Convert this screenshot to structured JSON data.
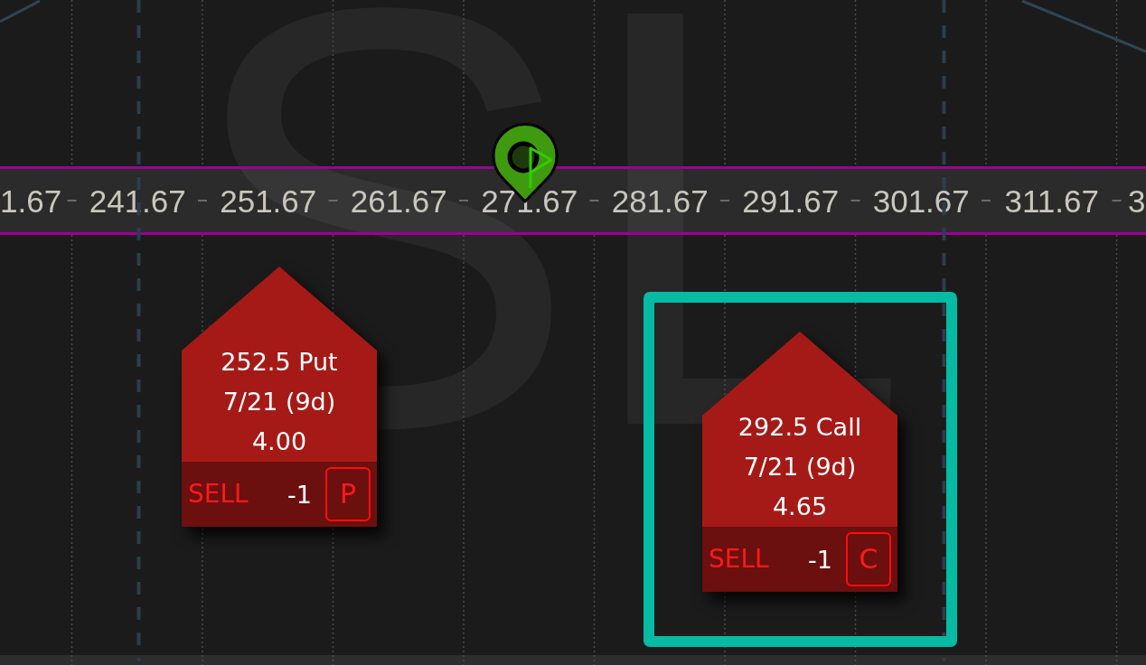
{
  "chart": {
    "background_symbol": "SL",
    "price_axis": {
      "labels": [
        "1.67",
        "241.67",
        "251.67",
        "261.67",
        "271.67",
        "281.67",
        "291.67",
        "301.67",
        "311.67",
        "3"
      ]
    },
    "orders": [
      {
        "strike": "252.5 Put",
        "expiration": "7/21 (9d)",
        "price": "4.00",
        "side": "SELL",
        "quantity": "-1",
        "type": "P",
        "selected": false
      },
      {
        "strike": "292.5 Call",
        "expiration": "7/21 (9d)",
        "price": "4.65",
        "side": "SELL",
        "quantity": "-1",
        "type": "C",
        "selected": true
      }
    ]
  }
}
